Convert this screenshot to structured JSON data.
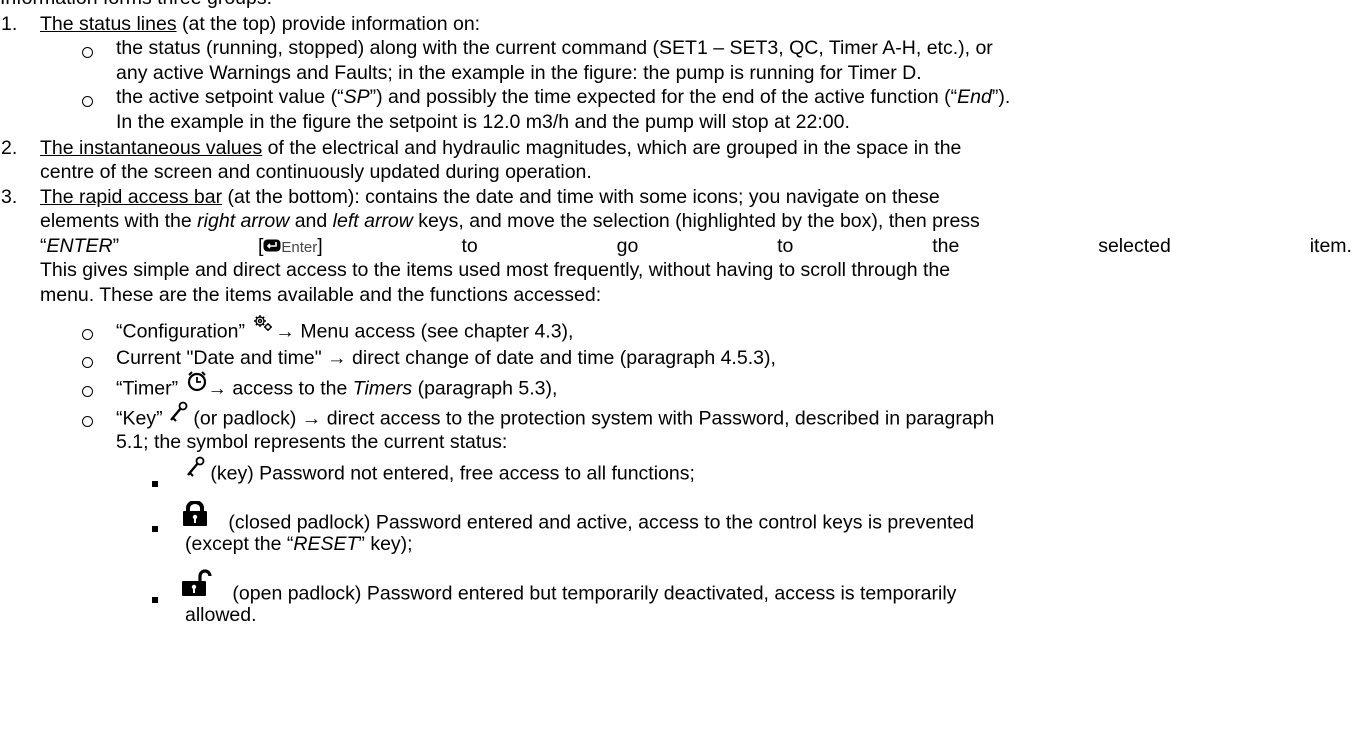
{
  "intro_partial": "Information forms three groups:",
  "items": {
    "i1": {
      "num": "1.",
      "title": "The status lines",
      "rest": " (at the top) provide information on:",
      "b1_l1": "the status (running, stopped) along with the current command (SET1 – SET3, QC, Timer A-H, etc.), or",
      "b1_l2": "any active Warnings and Faults; in the example in the figure: the pump is running for Timer D.",
      "b2_l1_a": "the active setpoint value (“",
      "b2_l1_sp": "SP",
      "b2_l1_b": "”) and possibly the time expected for the end of the active function (“",
      "b2_l1_end": "End",
      "b2_l1_c": "”).",
      "b2_l2": "In the example in the figure the setpoint is 12.0 m3/h and the pump will stop at 22:00."
    },
    "i2": {
      "num": "2.",
      "title": "The instantaneous values",
      "rest": " of the electrical and hydraulic magnitudes, which are grouped in the space in the",
      "l2": "centre of the screen and continuously updated during operation."
    },
    "i3": {
      "num": "3.",
      "title": "The rapid access bar",
      "rest": " (at the bottom): contains the date and time with some icons; you navigate on these",
      "l2_a": "elements with the ",
      "l2_right": "right arrow",
      "l2_b": " and ",
      "l2_left": "left arrow",
      "l2_c": " keys, and move the selection (highlighted by the box), then press",
      "l3_enter_q1": "“",
      "l3_enter": "ENTER",
      "l3_enter_q2": "”",
      "l3_key_open": "[",
      "l3_key_label": "Enter",
      "l3_key_close": "]",
      "l3_words": [
        "to",
        "go",
        "to",
        "the",
        "selected",
        "item."
      ],
      "l4": "This gives simple and direct access to the items used most frequently, without having to scroll through the",
      "l5": "menu. These are the items available and the functions accessed:",
      "opts": {
        "config": "“Configuration”",
        "config_rest": "→ Menu access (see chapter 4.3),",
        "datetime": "Current \"Date and time\" → direct change of date and time (paragraph 4.5.3),",
        "timer": "“Timer”",
        "timer_rest": "→ access to the ",
        "timer_timers": "Timers",
        "timer_tail": " (paragraph 5.3),",
        "key": "“Key”",
        "key_rest": " (or padlock) → direct access to the protection system with Password, described in paragraph",
        "key_l2": "5.1; the symbol represents the current status:"
      },
      "subs": {
        "s1": "(key) Password not entered, free access to all functions;",
        "s2_l1": "(closed padlock) Password entered and active, access to the control keys is prevented",
        "s2_l2_a": "(except the “",
        "s2_l2_reset": "RESET",
        "s2_l2_b": "” key);",
        "s3_l1": "(open padlock) Password entered but temporarily deactivated, access is temporarily",
        "s3_l2": "allowed."
      }
    }
  },
  "icons": [
    "gear-icon",
    "clock-icon",
    "key-icon",
    "closed-padlock-icon",
    "open-padlock-icon",
    "enter-key-icon"
  ]
}
